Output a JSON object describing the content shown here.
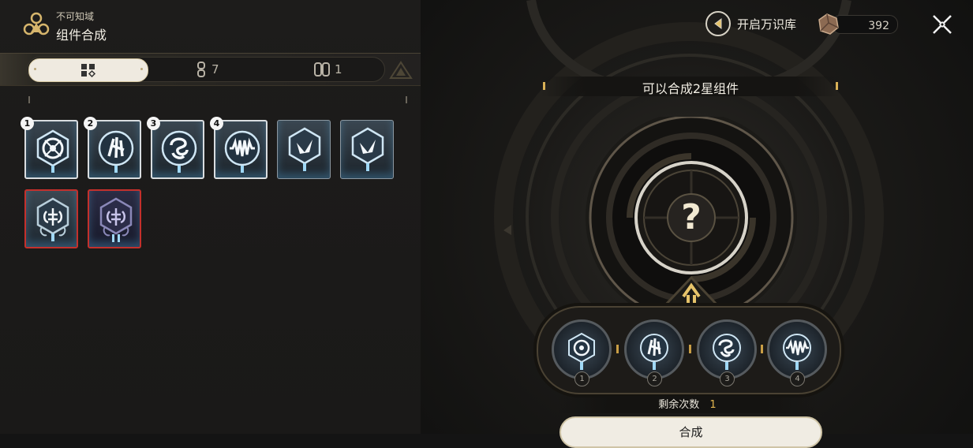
{
  "header": {
    "realm_title": "不可知域",
    "page_title": "组件合成"
  },
  "tabs": [
    {
      "label": "",
      "icon": "grid-icon",
      "active": true
    },
    {
      "label": "7",
      "icon": "component-chain-icon",
      "active": false
    },
    {
      "label": "1",
      "icon": "double-component-icon",
      "active": false
    }
  ],
  "inventory": {
    "cards": [
      {
        "badge": "1",
        "icon": "target-hex-icon",
        "border": "white"
      },
      {
        "badge": "2",
        "icon": "claw-hex-icon",
        "border": "white"
      },
      {
        "badge": "3",
        "icon": "swirl-hex-icon",
        "border": "white"
      },
      {
        "badge": "4",
        "icon": "waveform-hex-icon",
        "border": "white"
      },
      {
        "badge": "",
        "icon": "shard-hex-icon",
        "border": "grey"
      },
      {
        "badge": "",
        "icon": "shard-hex-icon",
        "border": "grey"
      },
      {
        "badge": "",
        "icon": "brain-hex-icon",
        "border": "red"
      },
      {
        "badge": "",
        "icon": "brain-hex-icon",
        "border": "red"
      }
    ]
  },
  "topbar": {
    "library_label": "开启万识库",
    "currency_amount": "392"
  },
  "synthesis": {
    "title": "可以合成2星组件",
    "result_symbol": "?",
    "slots": [
      {
        "num": "1",
        "icon": "target-hex-icon"
      },
      {
        "num": "2",
        "icon": "claw-hex-icon"
      },
      {
        "num": "3",
        "icon": "swirl-hex-icon"
      },
      {
        "num": "4",
        "icon": "waveform-hex-icon"
      }
    ],
    "remaining_label": "剩余次数",
    "remaining_value": "1",
    "button_label": "合成"
  },
  "colors": {
    "accent_gold": "#d8b056",
    "rarity_red": "#c4302c",
    "glow_blue": "#7fc8f0"
  }
}
